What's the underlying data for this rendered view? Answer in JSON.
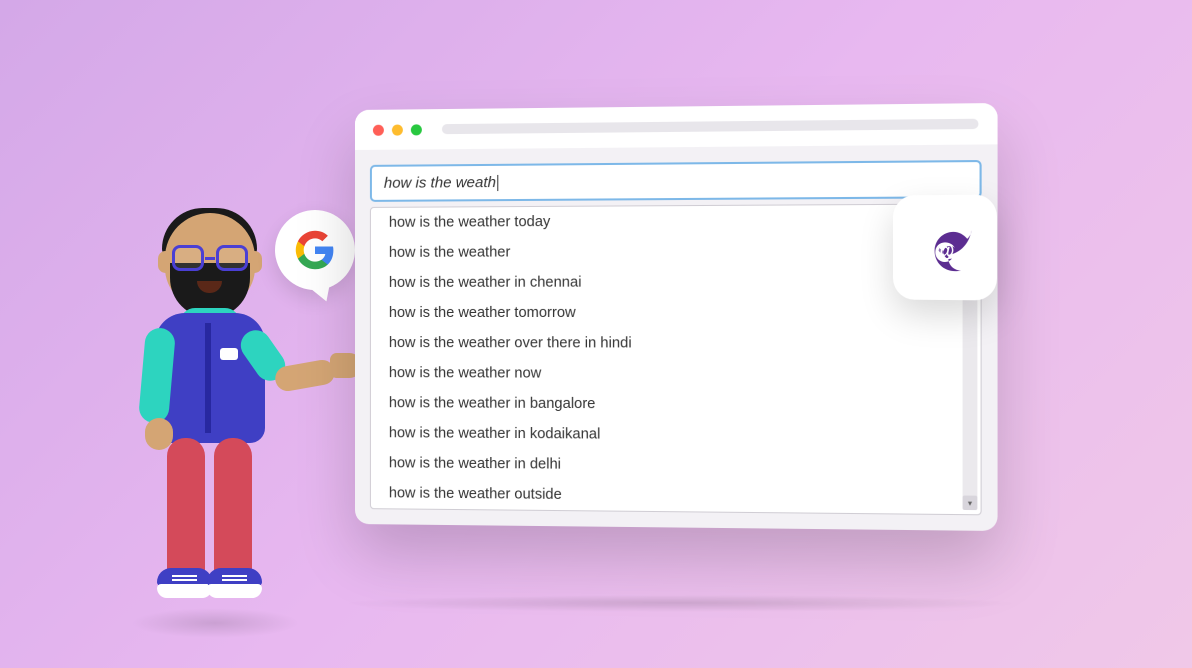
{
  "search": {
    "query": "how is the weath",
    "suggestions": [
      "how is the weather today",
      "how is the weather",
      "how is the weather in chennai",
      "how is the weather tomorrow",
      "how is the weather over there in hindi",
      "how is the weather now",
      "how is the weather in bangalore",
      "how is the weather in kodaikanal",
      "how is the weather in delhi",
      "how is the weather outside"
    ]
  },
  "icons": {
    "google": "G",
    "blazor": "blazor-logo"
  }
}
